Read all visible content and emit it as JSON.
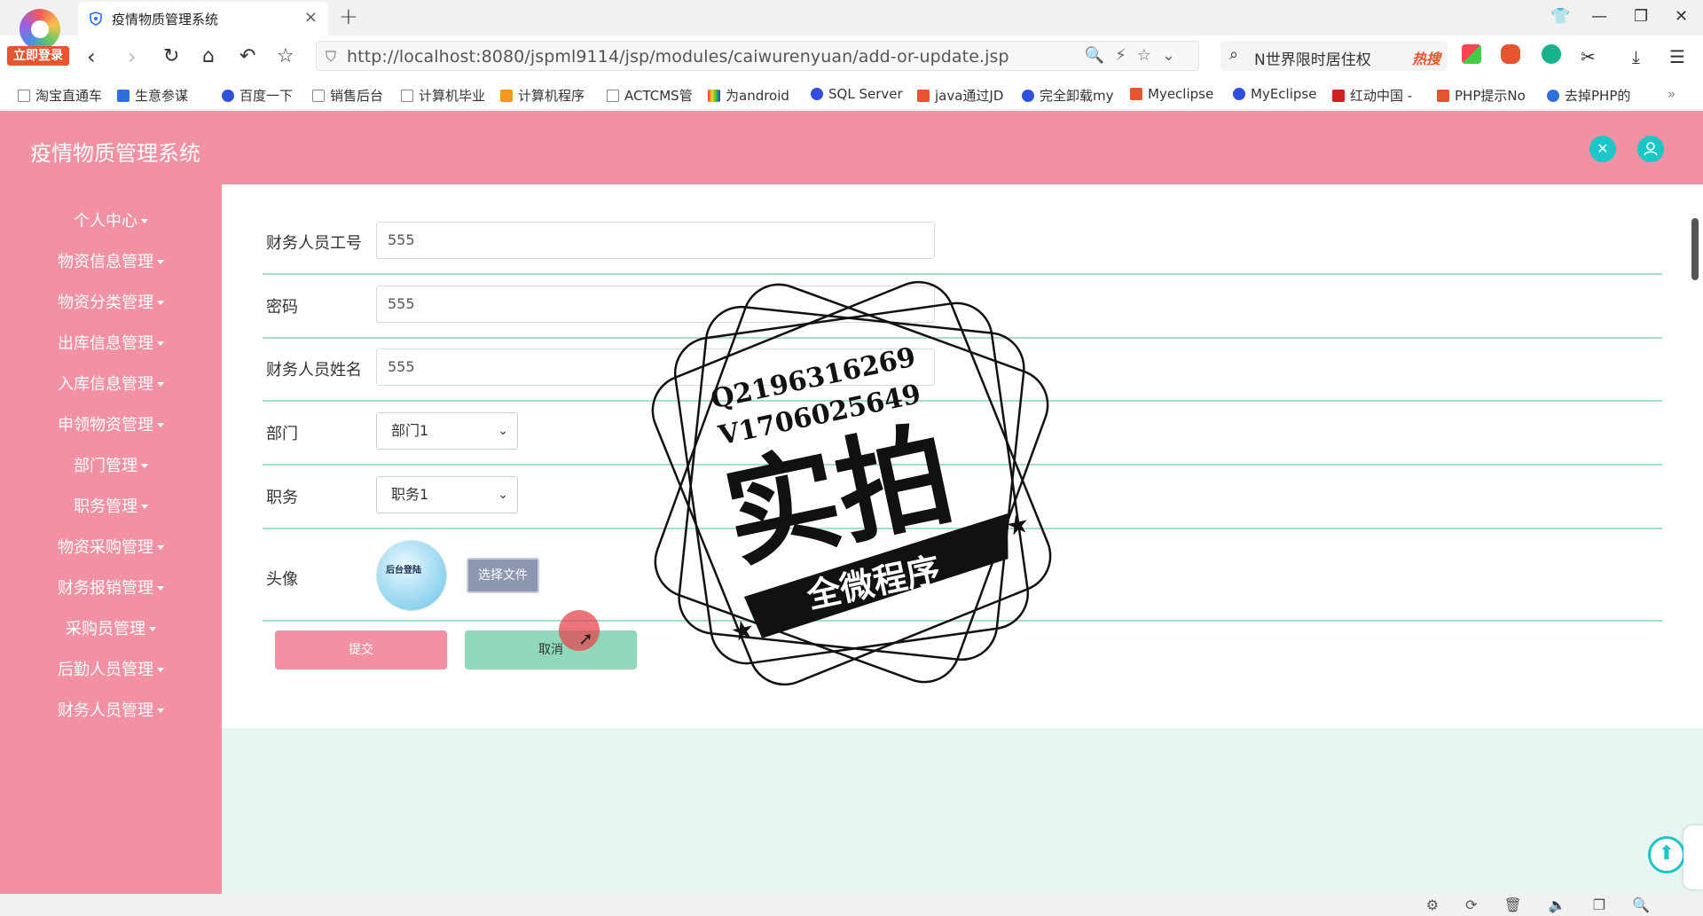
{
  "browser": {
    "login_badge": "立即登录",
    "tab_title": "疫情物质管理系统",
    "tab_close": "×",
    "new_tab": "+",
    "url": "http://localhost:8080/jspml9114/jsp/modules/caiwurenyuan/add-or-update.jsp",
    "search_text": "N世界限时居住权",
    "search_hot": "热搜",
    "bookmarks": [
      "淘宝直通车",
      "生意参谋",
      "百度一下",
      "销售后台",
      "计算机毕业",
      "计算机程序",
      "ACTCMS管",
      "为android",
      "SQL Server",
      "java通过JD",
      "完全卸载my",
      "Myeclipse",
      "MyEclipse",
      "红动中国 -",
      "PHP提示No",
      "去掉PHP的"
    ],
    "bookmark_more": "»"
  },
  "app": {
    "title": "疫情物质管理系统",
    "sidebar": [
      "个人中心",
      "物资信息管理",
      "物资分类管理",
      "出库信息管理",
      "入库信息管理",
      "申领物资管理",
      "部门管理",
      "职务管理",
      "物资采购管理",
      "财务报销管理",
      "采购员管理",
      "后勤人员管理",
      "财务人员管理"
    ],
    "form": {
      "staff_id_label": "财务人员工号",
      "staff_id_value": "555",
      "password_label": "密码",
      "password_value": "555",
      "name_label": "财务人员姓名",
      "name_value": "555",
      "department_label": "部门",
      "department_value": "部门1",
      "position_label": "职务",
      "position_value": "职务1",
      "avatar_label": "头像",
      "avatar_text": "后台登陆",
      "file_button": "选择文件",
      "submit": "提交",
      "cancel": "取消"
    }
  },
  "watermark": {
    "qq": "Q2196316269",
    "vx": "V1706025649",
    "main": "实拍",
    "banner": "全微程序"
  },
  "colors": {
    "brand_pink": "#f291a3",
    "accent_teal": "#1bc6c8",
    "cancel_green": "#8fd9ba",
    "divider": "#a8dccb"
  }
}
